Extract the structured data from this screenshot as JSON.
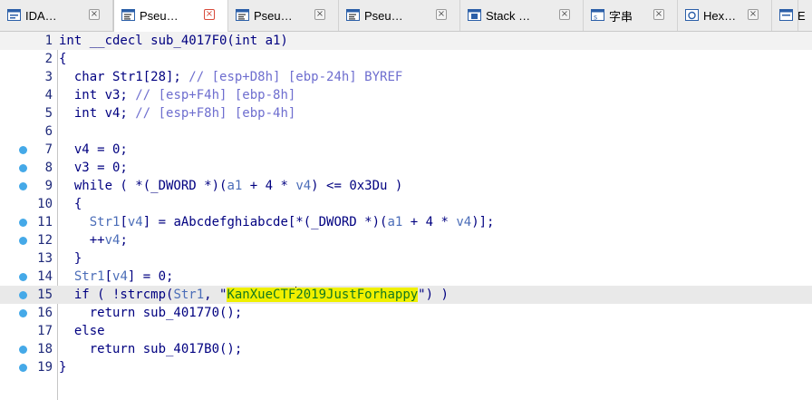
{
  "tabs": [
    {
      "label": "IDA…",
      "icon": "ida-view-icon",
      "active": false
    },
    {
      "label": "Pseu…",
      "icon": "pseudocode-icon",
      "active": true
    },
    {
      "label": "Pseu…",
      "icon": "pseudocode-icon",
      "active": false
    },
    {
      "label": "Pseu…",
      "icon": "pseudocode-icon",
      "active": false
    },
    {
      "label": "Stack  …",
      "icon": "stack-icon",
      "active": false
    },
    {
      "label": "字串",
      "icon": "strings-icon",
      "active": false
    },
    {
      "label": "Hex…",
      "icon": "hex-view-icon",
      "active": false
    },
    {
      "label": "E",
      "icon": "enums-icon",
      "active": false
    }
  ],
  "code_lines": [
    {
      "num": "1",
      "dot": false,
      "parts": [
        {
          "t": "int __cdecl sub_4017F0(int a1)",
          "c": ""
        }
      ]
    },
    {
      "num": "2",
      "dot": false,
      "parts": [
        {
          "t": "{",
          "c": ""
        }
      ]
    },
    {
      "num": "3",
      "dot": false,
      "parts": [
        {
          "t": "  char Str1[28]; ",
          "c": ""
        },
        {
          "t": "// [esp+D8h] [ebp-24h] BYREF",
          "c": "cmt"
        }
      ]
    },
    {
      "num": "4",
      "dot": false,
      "parts": [
        {
          "t": "  int v3; ",
          "c": ""
        },
        {
          "t": "// [esp+F4h] [ebp-8h]",
          "c": "cmt"
        }
      ]
    },
    {
      "num": "5",
      "dot": false,
      "parts": [
        {
          "t": "  int v4; ",
          "c": ""
        },
        {
          "t": "// [esp+F8h] [ebp-4h]",
          "c": "cmt"
        }
      ]
    },
    {
      "num": "6",
      "dot": false,
      "parts": []
    },
    {
      "num": "7",
      "dot": true,
      "parts": [
        {
          "t": "  v4 = 0;",
          "c": ""
        }
      ]
    },
    {
      "num": "8",
      "dot": true,
      "parts": [
        {
          "t": "  v3 = 0;",
          "c": ""
        }
      ]
    },
    {
      "num": "9",
      "dot": true,
      "parts": [
        {
          "t": "  while ( *(_DWORD *)(",
          "c": ""
        },
        {
          "t": "a1",
          "c": "var"
        },
        {
          "t": " + 4 * ",
          "c": ""
        },
        {
          "t": "v4",
          "c": "var"
        },
        {
          "t": ") <= 0x3Du )",
          "c": ""
        }
      ]
    },
    {
      "num": "10",
      "dot": false,
      "parts": [
        {
          "t": "  {",
          "c": ""
        }
      ]
    },
    {
      "num": "11",
      "dot": true,
      "parts": [
        {
          "t": "    ",
          "c": ""
        },
        {
          "t": "Str1",
          "c": "var"
        },
        {
          "t": "[",
          "c": ""
        },
        {
          "t": "v4",
          "c": "var"
        },
        {
          "t": "] = aAbcdefghiabcde[*(_DWORD *)(",
          "c": ""
        },
        {
          "t": "a1",
          "c": "var"
        },
        {
          "t": " + 4 * ",
          "c": ""
        },
        {
          "t": "v4",
          "c": "var"
        },
        {
          "t": ")];",
          "c": ""
        }
      ]
    },
    {
      "num": "12",
      "dot": true,
      "parts": [
        {
          "t": "    ++",
          "c": ""
        },
        {
          "t": "v4",
          "c": "var"
        },
        {
          "t": ";",
          "c": ""
        }
      ]
    },
    {
      "num": "13",
      "dot": false,
      "parts": [
        {
          "t": "  }",
          "c": ""
        }
      ]
    },
    {
      "num": "14",
      "dot": true,
      "parts": [
        {
          "t": "  ",
          "c": ""
        },
        {
          "t": "Str1",
          "c": "var"
        },
        {
          "t": "[",
          "c": ""
        },
        {
          "t": "v4",
          "c": "var"
        },
        {
          "t": "] = 0;",
          "c": ""
        }
      ]
    },
    {
      "num": "15",
      "dot": true,
      "highlight": true,
      "parts": [
        {
          "t": "  if ( !strcmp(",
          "c": ""
        },
        {
          "t": "Str1",
          "c": "var"
        },
        {
          "t": ", \"",
          "c": ""
        },
        {
          "t": "KanXueCTF",
          "c": "str"
        },
        {
          "t": "",
          "c": "cursor"
        },
        {
          "t": "2019JustForhappy",
          "c": "str"
        },
        {
          "t": "\") )",
          "c": ""
        }
      ]
    },
    {
      "num": "16",
      "dot": true,
      "parts": [
        {
          "t": "    return sub_401770();",
          "c": ""
        }
      ]
    },
    {
      "num": "17",
      "dot": false,
      "parts": [
        {
          "t": "  else",
          "c": ""
        }
      ]
    },
    {
      "num": "18",
      "dot": true,
      "parts": [
        {
          "t": "    return sub_4017B0();",
          "c": ""
        }
      ]
    },
    {
      "num": "19",
      "dot": true,
      "parts": [
        {
          "t": "}",
          "c": ""
        }
      ]
    }
  ],
  "colors": {
    "keyword": "#000080",
    "variable": "#4b6db8",
    "comment": "#6e6ecf",
    "string_bg": "#f0f000",
    "string_fg": "#15781f",
    "breakpoint_dot": "#45a9e8"
  }
}
